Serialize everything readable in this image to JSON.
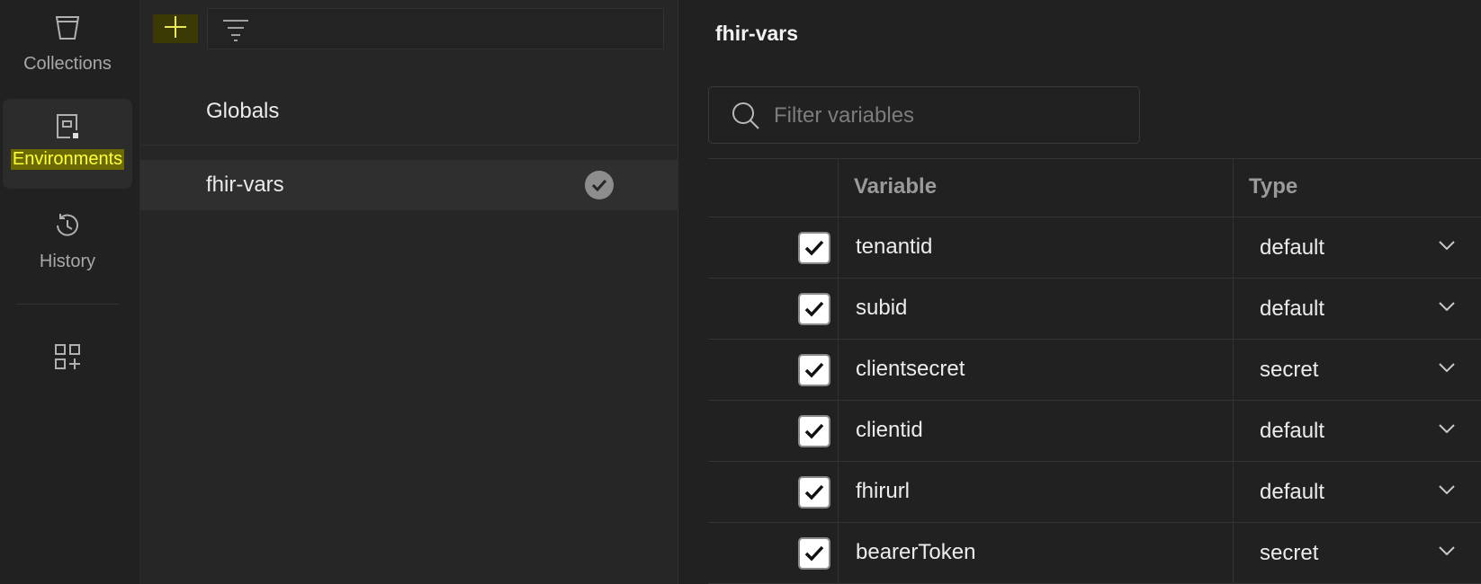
{
  "rail": {
    "items": [
      {
        "label": "Collections",
        "icon": "trash-bin-icon"
      },
      {
        "label": "Environments",
        "icon": "environment-icon"
      },
      {
        "label": "History",
        "icon": "history-icon"
      }
    ],
    "extra_icon": "apps-add-icon"
  },
  "mid": {
    "environments": [
      {
        "label": "Globals"
      },
      {
        "label": "fhir-vars",
        "active": true
      }
    ]
  },
  "right": {
    "title": "fhir-vars",
    "search": {
      "placeholder": "Filter variables",
      "value": ""
    },
    "table": {
      "headers": {
        "variable": "Variable",
        "type": "Type"
      },
      "rows": [
        {
          "checked": true,
          "variable": "tenantid",
          "type": "default"
        },
        {
          "checked": true,
          "variable": "subid",
          "type": "default"
        },
        {
          "checked": true,
          "variable": "clientsecret",
          "type": "secret"
        },
        {
          "checked": true,
          "variable": "clientid",
          "type": "default"
        },
        {
          "checked": true,
          "variable": "fhirurl",
          "type": "default"
        },
        {
          "checked": true,
          "variable": "bearerToken",
          "type": "secret"
        }
      ]
    }
  },
  "colors": {
    "accent_highlight": "#ffff3a",
    "add_button_bg": "#3b3a05",
    "background": "#212121"
  }
}
